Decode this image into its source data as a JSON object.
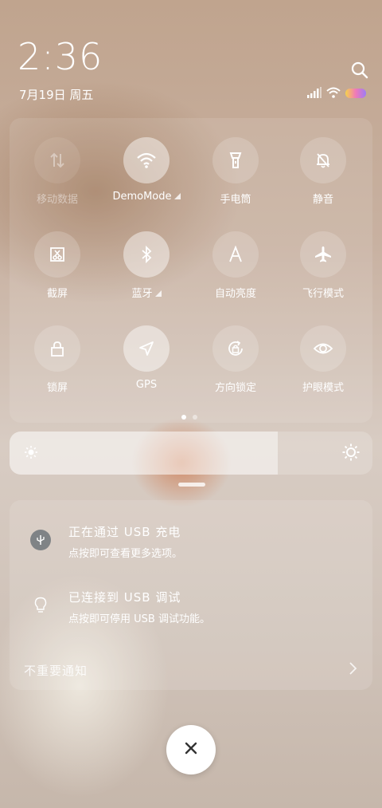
{
  "status": {
    "time": "2:36",
    "date": "7月19日 周五",
    "search_icon": "search-icon",
    "icons": [
      "signal-icon",
      "wifi-icon",
      "battery-icon"
    ]
  },
  "quick_settings": {
    "tiles": [
      {
        "id": "mobile-data",
        "label": "移动数据",
        "icon": "mobile-data-icon",
        "on": false,
        "disabled": true,
        "has_menu": false
      },
      {
        "id": "wifi",
        "label": "DemoMode",
        "icon": "wifi-icon",
        "on": true,
        "disabled": false,
        "has_menu": true
      },
      {
        "id": "flashlight",
        "label": "手电筒",
        "icon": "flashlight-icon",
        "on": false,
        "disabled": false,
        "has_menu": false
      },
      {
        "id": "mute",
        "label": "静音",
        "icon": "bell-off-icon",
        "on": false,
        "disabled": false,
        "has_menu": false
      },
      {
        "id": "screenshot",
        "label": "截屏",
        "icon": "screenshot-icon",
        "on": false,
        "disabled": false,
        "has_menu": false
      },
      {
        "id": "bluetooth",
        "label": "蓝牙",
        "icon": "bluetooth-icon",
        "on": true,
        "disabled": false,
        "has_menu": true
      },
      {
        "id": "auto-brightness",
        "label": "自动亮度",
        "icon": "auto-brightness-icon",
        "on": false,
        "disabled": false,
        "has_menu": false
      },
      {
        "id": "airplane",
        "label": "飞行模式",
        "icon": "airplane-icon",
        "on": false,
        "disabled": false,
        "has_menu": false
      },
      {
        "id": "lock-screen",
        "label": "锁屏",
        "icon": "lock-icon",
        "on": false,
        "disabled": false,
        "has_menu": false
      },
      {
        "id": "gps",
        "label": "GPS",
        "icon": "gps-icon",
        "on": true,
        "disabled": false,
        "has_menu": false
      },
      {
        "id": "rotation-lock",
        "label": "方向锁定",
        "icon": "rotation-lock-icon",
        "on": false,
        "disabled": false,
        "has_menu": false
      },
      {
        "id": "eye-care",
        "label": "护眼模式",
        "icon": "eye-icon",
        "on": false,
        "disabled": false,
        "has_menu": false
      }
    ],
    "pages": 2,
    "current_page": 1
  },
  "brightness": {
    "level": 0.74,
    "low_icon": "sun-small-icon",
    "high_icon": "sun-large-icon"
  },
  "notifications": [
    {
      "icon": "usb-icon",
      "title": "正在通过 USB 充电",
      "body": "点按即可查看更多选项。"
    },
    {
      "icon": "bulb-icon",
      "title": "已连接到 USB 调试",
      "body": "点按即可停用 USB 调试功能。"
    }
  ],
  "unimportant": {
    "label": "不重要通知",
    "icon": "chevron-right-icon"
  },
  "close": {
    "icon": "close-icon"
  }
}
